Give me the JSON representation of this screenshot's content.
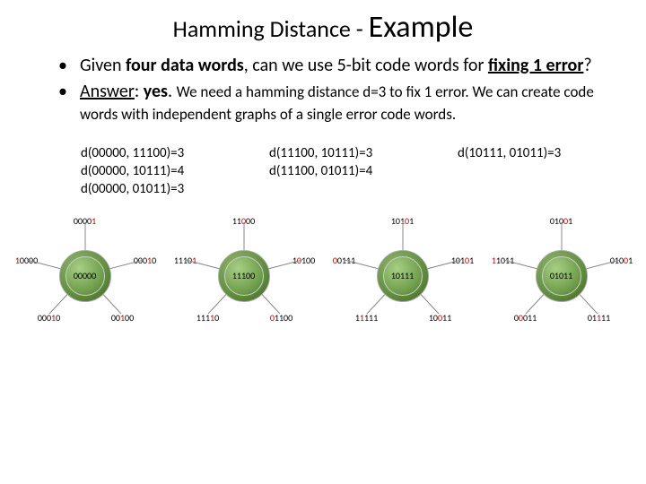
{
  "title": {
    "prefix": "Hamming Distance - ",
    "emphasis": "Example"
  },
  "bullets": {
    "b1_pre": "Given ",
    "b1_bold1": "four data words",
    "b1_mid": ", can we use 5-bit code words for ",
    "b1_bold2": "fixing 1 error",
    "b1_post": "?",
    "b2_ans": "Answer",
    "b2_sep": ": ",
    "b2_yes": "yes",
    "b2_rest1": ". ",
    "b2_rest2": "We need a hamming distance d=3 to fix 1 error. We can create code words with independent graphs of a single error code words."
  },
  "distances": {
    "col1": [
      "d(00000, 11100)=3",
      "d(00000, 10111)=4",
      "d(00000, 01011)=3"
    ],
    "col2": [
      "d(11100, 10111)=3",
      "d(11100, 01011)=4"
    ],
    "col3": [
      "d(10111, 01011)=3"
    ]
  },
  "graphs": [
    {
      "center": "00000",
      "nodes": [
        {
          "plain": "0000",
          "red": "1"
        },
        {
          "plain": "000",
          "red": "1",
          "plain2": "0"
        },
        {
          "plain": "00",
          "red": "1",
          "plain2": "00"
        },
        {
          "plain": "000",
          "red": "1",
          "plain2": "0",
          "dup": true,
          "alt": "0",
          "altRed": "1",
          "altPlain2": "000"
        },
        {
          "red": "1",
          "plain2": "0000"
        }
      ]
    },
    {
      "center": "11100",
      "nodes": [
        {
          "plain": "11",
          "red": "0",
          "plain2": "00"
        },
        {
          "plain": "1",
          "red": "0",
          "plain2": "100"
        },
        {
          "plain": "111",
          "red": "1",
          "plain2": "0"
        },
        {
          "red": "0",
          "plain2": "1100"
        },
        {
          "plain": "1110",
          "red": "1"
        }
      ],
      "specialTop": {
        "plain": "1",
        "red": "0",
        "plain2": "100",
        "hidden": true
      }
    },
    {
      "center": "10111",
      "nodes": [
        {
          "plain": "101",
          "red": "0",
          "plain2": "1"
        },
        {
          "red": "0",
          "plain2": "0111"
        },
        {
          "plain": "101",
          "red": "0",
          "plain2": "1"
        },
        {
          "plain": "10",
          "red": "0",
          "plain2": "11"
        },
        {
          "plain": "1",
          "red": "1",
          "plain2": "111"
        }
      ]
    },
    {
      "center": "01011",
      "nodes": [
        {
          "plain": "010",
          "red": "0",
          "plain2": "1"
        },
        {
          "red": "1",
          "plain2": "1011"
        },
        {
          "plain": "010",
          "red": "0",
          "plain2": "1"
        },
        {
          "plain": "01",
          "red": "1",
          "plain2": "11"
        },
        {
          "plain": "0",
          "red": "0",
          "plain2": "011"
        }
      ]
    }
  ],
  "graphs_display": [
    {
      "center": "00000",
      "top": [
        [
          "0000",
          ""
        ],
        [
          "1",
          "r"
        ]
      ],
      "right": [
        [
          "000",
          ""
        ],
        [
          "1",
          "r"
        ],
        [
          "0",
          ""
        ]
      ],
      "br": [
        [
          "00",
          ""
        ],
        [
          "1",
          "r"
        ],
        [
          "00",
          ""
        ]
      ],
      "bl": [
        [
          "000",
          ""
        ],
        [
          "1",
          "r"
        ],
        [
          "0",
          ""
        ]
      ],
      "left": [
        [
          "1",
          "r"
        ],
        [
          "0000",
          ""
        ]
      ]
    },
    {
      "center": "11100",
      "top": [
        [
          "11",
          ""
        ],
        [
          "0",
          "r"
        ],
        [
          "00",
          ""
        ]
      ],
      "right": [
        [
          "1",
          ""
        ],
        [
          "0",
          "r"
        ],
        [
          "100",
          ""
        ]
      ],
      "br": [
        [
          "0",
          "r"
        ],
        [
          "1100",
          ""
        ]
      ],
      "bl": [
        [
          "111",
          ""
        ],
        [
          "1",
          "r"
        ],
        [
          "0",
          ""
        ]
      ],
      "left": [
        [
          "1110",
          ""
        ],
        [
          "1",
          "r"
        ]
      ]
    },
    {
      "center": "10111",
      "top": [
        [
          "101",
          ""
        ],
        [
          "0",
          "r"
        ],
        [
          "1",
          ""
        ]
      ],
      "right": [
        [
          "101",
          ""
        ],
        [
          "0",
          "r"
        ],
        [
          "1",
          ""
        ]
      ],
      "br": [
        [
          "10",
          ""
        ],
        [
          "0",
          "r"
        ],
        [
          "11",
          ""
        ]
      ],
      "bl": [
        [
          "1",
          ""
        ],
        [
          "1",
          "r"
        ],
        [
          "111",
          ""
        ]
      ],
      "left": [
        [
          "0",
          "r"
        ],
        [
          "0111",
          ""
        ]
      ]
    },
    {
      "center": "01011",
      "top": [
        [
          "010",
          ""
        ],
        [
          "0",
          "r"
        ],
        [
          "1",
          ""
        ]
      ],
      "right": [
        [
          "010",
          ""
        ],
        [
          "0",
          "r"
        ],
        [
          "1",
          ""
        ]
      ],
      "br": [
        [
          "01",
          ""
        ],
        [
          "1",
          "r"
        ],
        [
          "11",
          ""
        ]
      ],
      "bl": [
        [
          "0",
          ""
        ],
        [
          "0",
          "r"
        ],
        [
          "011",
          ""
        ]
      ],
      "left": [
        [
          "1",
          "r"
        ],
        [
          "1011",
          ""
        ]
      ]
    }
  ]
}
